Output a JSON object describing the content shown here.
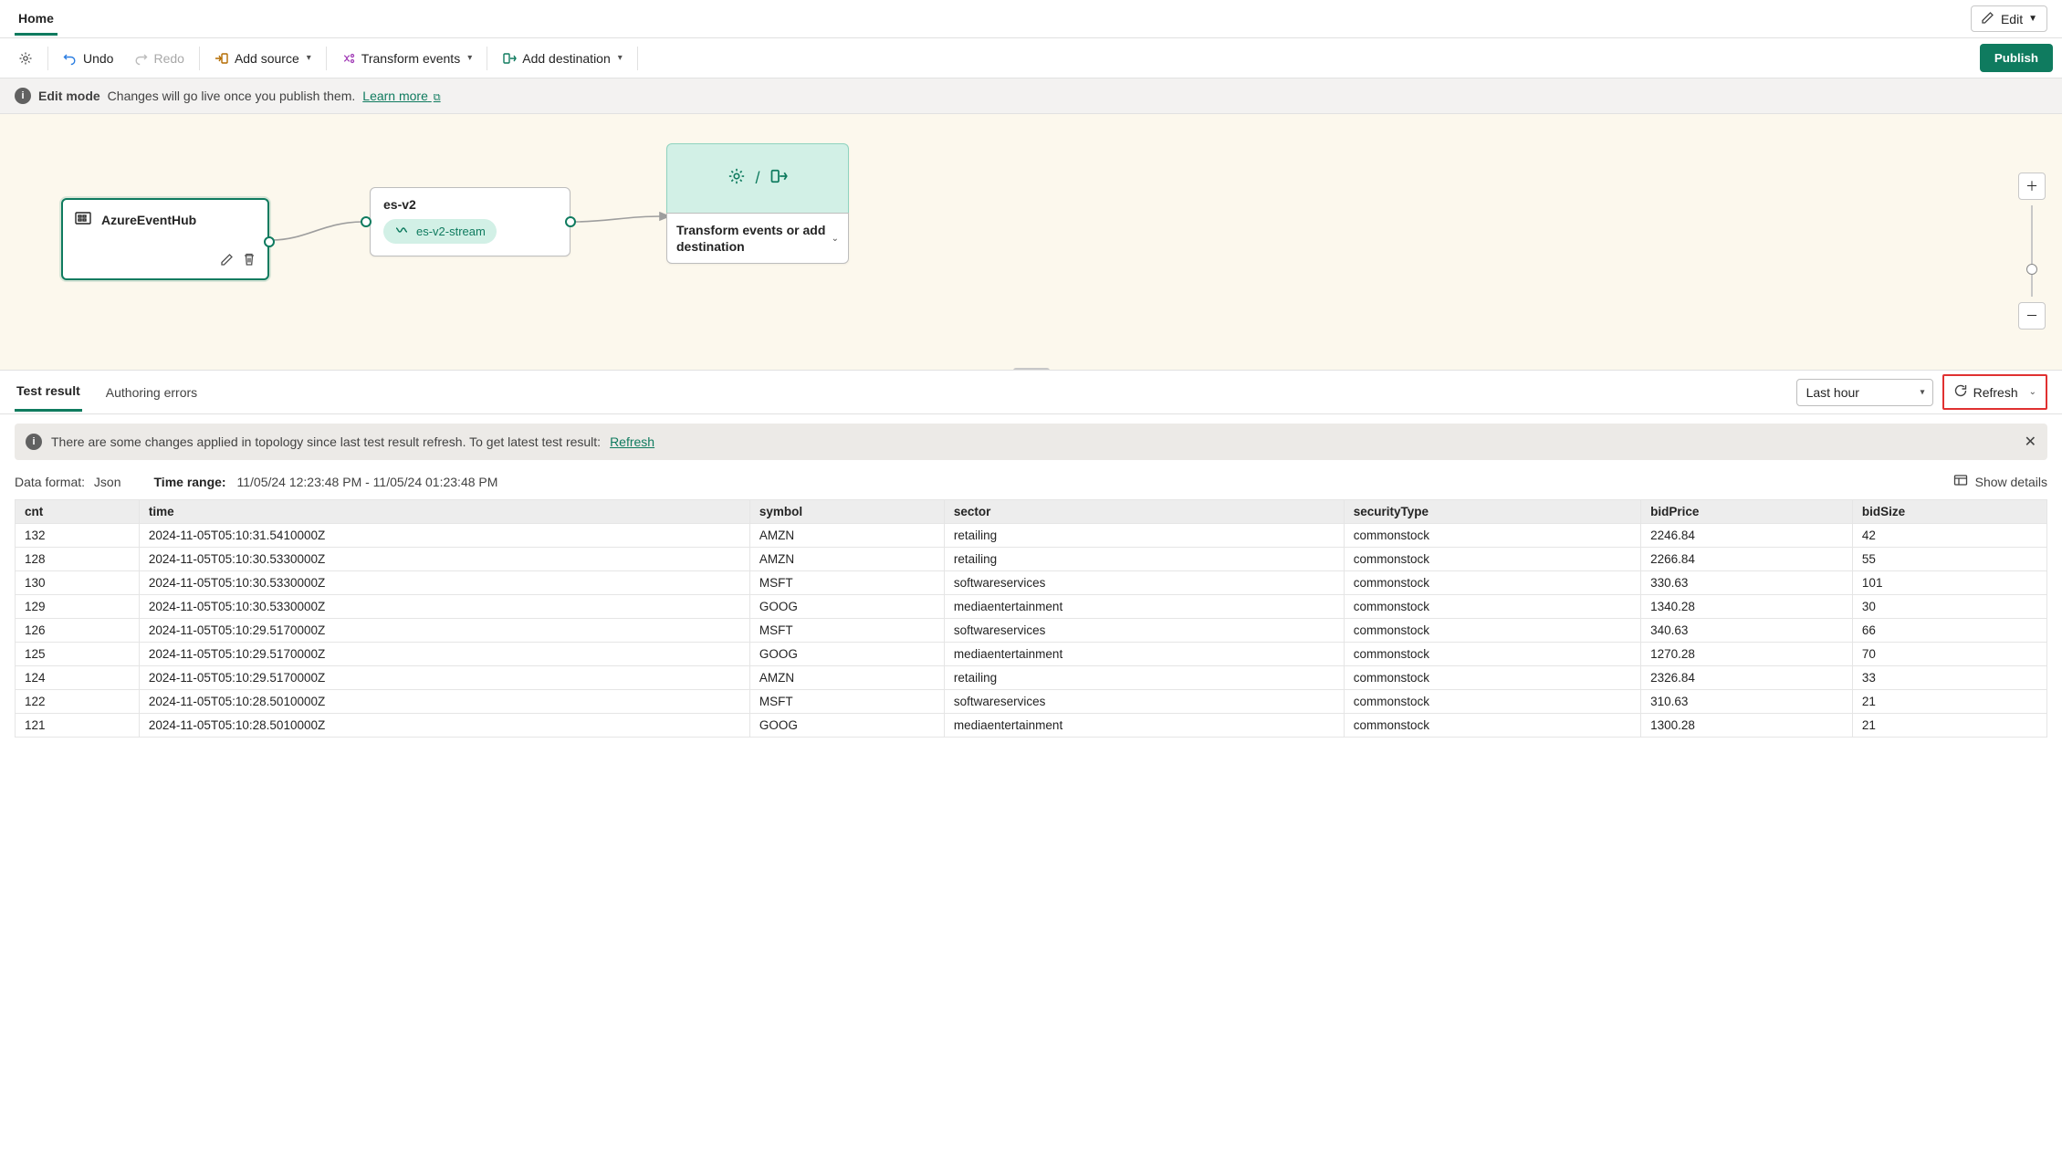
{
  "tabs": {
    "home": "Home"
  },
  "editDropdown": {
    "label": "Edit"
  },
  "toolbar": {
    "undo": "Undo",
    "redo": "Redo",
    "addSource": "Add source",
    "transformEvents": "Transform events",
    "addDestination": "Add destination",
    "publish": "Publish"
  },
  "infobar": {
    "title": "Edit mode",
    "message": "Changes will go live once you publish them.",
    "learnMore": "Learn more"
  },
  "canvas": {
    "sourceNode": {
      "title": "AzureEventHub"
    },
    "streamNode": {
      "title": "es-v2",
      "pill": "es-v2-stream"
    },
    "destNode": {
      "placeholder": "Transform events or add destination"
    }
  },
  "panel": {
    "tabs": {
      "testResult": "Test result",
      "authoringErrors": "Authoring errors"
    },
    "timeRangeSelect": "Last hour",
    "refresh": "Refresh",
    "alert": {
      "message": "There are some changes applied in topology since last test result refresh. To get latest test result:",
      "linkText": "Refresh"
    },
    "meta": {
      "dataFormatLabel": "Data format:",
      "dataFormatValue": "Json",
      "timeRangeLabel": "Time range:",
      "timeRangeValue": "11/05/24 12:23:48 PM - 11/05/24 01:23:48 PM",
      "showDetails": "Show details"
    },
    "columns": [
      "cnt",
      "time",
      "symbol",
      "sector",
      "securityType",
      "bidPrice",
      "bidSize"
    ],
    "rows": [
      {
        "cnt": "132",
        "time": "2024-11-05T05:10:31.5410000Z",
        "symbol": "AMZN",
        "sector": "retailing",
        "securityType": "commonstock",
        "bidPrice": "2246.84",
        "bidSize": "42"
      },
      {
        "cnt": "128",
        "time": "2024-11-05T05:10:30.5330000Z",
        "symbol": "AMZN",
        "sector": "retailing",
        "securityType": "commonstock",
        "bidPrice": "2266.84",
        "bidSize": "55"
      },
      {
        "cnt": "130",
        "time": "2024-11-05T05:10:30.5330000Z",
        "symbol": "MSFT",
        "sector": "softwareservices",
        "securityType": "commonstock",
        "bidPrice": "330.63",
        "bidSize": "101"
      },
      {
        "cnt": "129",
        "time": "2024-11-05T05:10:30.5330000Z",
        "symbol": "GOOG",
        "sector": "mediaentertainment",
        "securityType": "commonstock",
        "bidPrice": "1340.28",
        "bidSize": "30"
      },
      {
        "cnt": "126",
        "time": "2024-11-05T05:10:29.5170000Z",
        "symbol": "MSFT",
        "sector": "softwareservices",
        "securityType": "commonstock",
        "bidPrice": "340.63",
        "bidSize": "66"
      },
      {
        "cnt": "125",
        "time": "2024-11-05T05:10:29.5170000Z",
        "symbol": "GOOG",
        "sector": "mediaentertainment",
        "securityType": "commonstock",
        "bidPrice": "1270.28",
        "bidSize": "70"
      },
      {
        "cnt": "124",
        "time": "2024-11-05T05:10:29.5170000Z",
        "symbol": "AMZN",
        "sector": "retailing",
        "securityType": "commonstock",
        "bidPrice": "2326.84",
        "bidSize": "33"
      },
      {
        "cnt": "122",
        "time": "2024-11-05T05:10:28.5010000Z",
        "symbol": "MSFT",
        "sector": "softwareservices",
        "securityType": "commonstock",
        "bidPrice": "310.63",
        "bidSize": "21"
      },
      {
        "cnt": "121",
        "time": "2024-11-05T05:10:28.5010000Z",
        "symbol": "GOOG",
        "sector": "mediaentertainment",
        "securityType": "commonstock",
        "bidPrice": "1300.28",
        "bidSize": "21"
      }
    ]
  }
}
